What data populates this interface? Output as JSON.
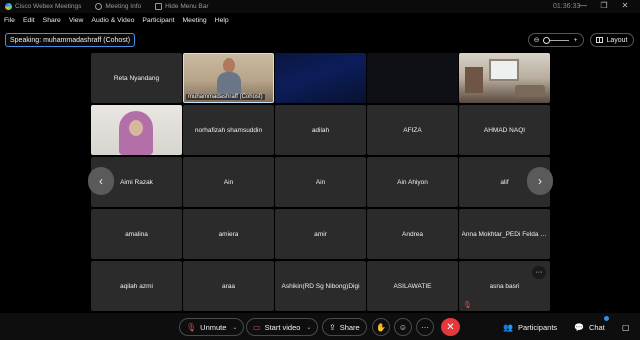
{
  "titlebar": {
    "app_title": "Cisco Webex Meetings",
    "meeting_info": "Meeting Info",
    "hide_menu_bar": "Hide Menu Bar",
    "clock": "01:36:33",
    "minimize_glyph": "—",
    "restore_glyph": "❐",
    "close_glyph": "✕"
  },
  "menu": [
    {
      "label": "File"
    },
    {
      "label": "Edit"
    },
    {
      "label": "Share"
    },
    {
      "label": "View"
    },
    {
      "label": "Audio & Video"
    },
    {
      "label": "Participant"
    },
    {
      "label": "Meeting"
    },
    {
      "label": "Help"
    }
  ],
  "speaking": "Speaking: muhammadashraff (Cohost)",
  "layout_label": "Layout",
  "tiles": {
    "r1": [
      "Reta Nyandang",
      "muhammadashraff (Cohost)",
      "",
      "",
      ""
    ],
    "r2": [
      "",
      "norhafizah shamsuddin",
      "adilah",
      "AFIZA",
      "AHMAD NAQI"
    ],
    "r3": [
      "Aimi Razak",
      "Ain",
      "Ain",
      "Ain Ahiyon",
      "alif"
    ],
    "r4": [
      "amalina",
      "amiera",
      "amir",
      "Andrea",
      "Anna Mokhtar_PEDi Felda Su..."
    ],
    "r5": [
      "aqilah azmi",
      "araa",
      "Ashikin(RD Sg Nibong)Digi",
      "ASILAWATIE",
      "asna basri"
    ]
  },
  "nav": {
    "prev": "‹",
    "next": "›"
  },
  "more": "···",
  "toolbar": {
    "unmute": "Unmute",
    "start_video": "Start video",
    "share": "Share",
    "participants": "Participants",
    "chat": "Chat",
    "more": "···",
    "end": "✕"
  },
  "colors": {
    "end_call": "#e5383b",
    "speaking_border": "#4a90e2",
    "muted": "#e24b4b"
  }
}
